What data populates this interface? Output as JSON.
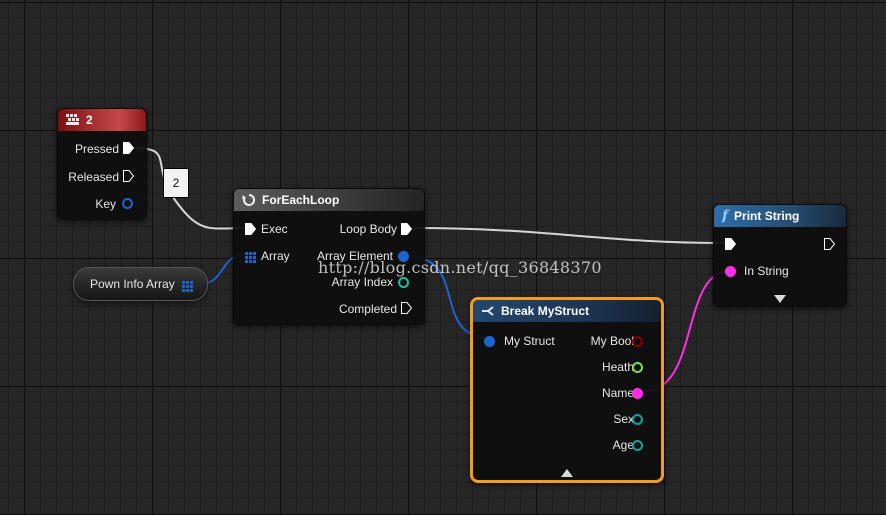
{
  "nodes": {
    "key_event": {
      "title": "2",
      "pins": {
        "pressed": "Pressed",
        "released": "Released",
        "key": "Key"
      }
    },
    "comment_box": {
      "text": "2"
    },
    "array_var": {
      "label": "Pown Info Array"
    },
    "foreach": {
      "title": "ForEachLoop",
      "inputs": {
        "exec": "Exec",
        "array": "Array"
      },
      "outputs": {
        "loop_body": "Loop Body",
        "array_element": "Array Element",
        "array_index": "Array Index",
        "completed": "Completed"
      }
    },
    "print_string": {
      "title": "Print String",
      "function_glyph": "f",
      "inputs": {
        "in_string": "In String"
      }
    },
    "break_struct": {
      "title": "Break MyStruct",
      "input": "My Struct",
      "outputs": {
        "my_bool": "My Bool",
        "heath": "Heath",
        "name": "Name",
        "sex": "Sex",
        "age": "Age"
      }
    }
  },
  "watermark": "http://blog.csdn.net/qq_36848370",
  "icons": {
    "key_event": "keyboard-icon",
    "foreach": "loop-icon",
    "break_struct": "break-struct-icon",
    "print_string": "function-icon",
    "array": "array-grid-icon",
    "expand": "triangle-down-icon",
    "collapse": "triangle-up-icon"
  },
  "colors": {
    "exec": "#ffffff",
    "struct_pin": "#1e64d0",
    "bool_pin": "#8b0000",
    "int_pin": "#7ed957",
    "string_pin": "#ff2ee6",
    "sex_age_pin": "#12a0a0",
    "key_header": "#8c1111",
    "selection": "#f29c1f"
  }
}
